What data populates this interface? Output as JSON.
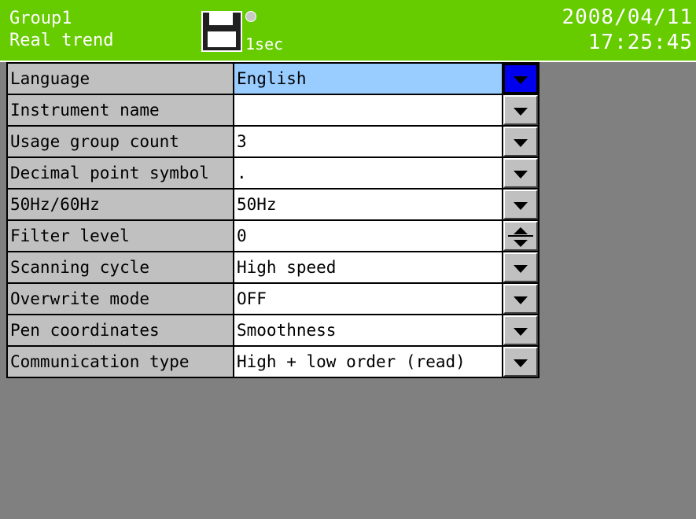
{
  "header": {
    "group": "Group1",
    "mode": "Real trend",
    "interval": "1sec",
    "date": "2008/04/11",
    "time": "17:25:45",
    "bg_color": "#66cc00"
  },
  "settings": [
    {
      "label": "Language",
      "value": "English",
      "control": "dropdown",
      "selected": true
    },
    {
      "label": "Instrument name",
      "value": "",
      "control": "dropdown"
    },
    {
      "label": "Usage group count",
      "value": "3",
      "control": "dropdown"
    },
    {
      "label": "Decimal point symbol",
      "value": ".",
      "control": "dropdown"
    },
    {
      "label": "50Hz/60Hz",
      "value": "50Hz",
      "control": "dropdown"
    },
    {
      "label": "Filter level",
      "value": "0",
      "control": "spinner"
    },
    {
      "label": "Scanning cycle",
      "value": "High speed",
      "control": "dropdown"
    },
    {
      "label": "Overwrite mode",
      "value": "OFF",
      "control": "dropdown"
    },
    {
      "label": "Pen coordinates",
      "value": "Smoothness",
      "control": "dropdown"
    },
    {
      "label": "Communication type",
      "value": "High + low order (read)",
      "control": "dropdown"
    }
  ],
  "icons": {
    "storage": "floppy-disk-icon",
    "status": "status-led-icon",
    "dropdown": "chevron-down-icon",
    "spinner": "spinner-icon"
  }
}
